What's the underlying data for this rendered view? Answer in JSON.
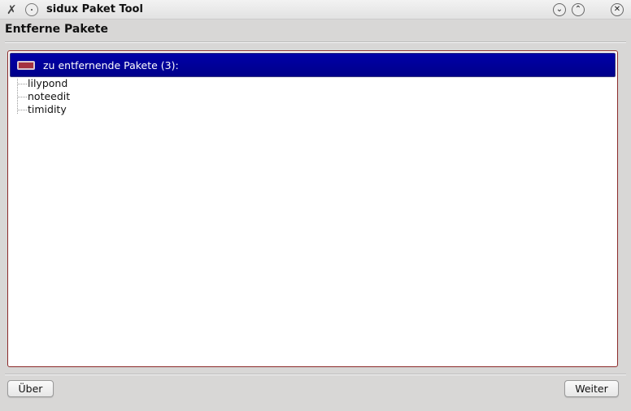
{
  "window": {
    "title": "sidux Paket Tool",
    "app_icon": "tools-icon",
    "buttons": [
      "minimize",
      "maximize",
      "close"
    ]
  },
  "page": {
    "title": "Entferne Pakete"
  },
  "tree": {
    "header": "zu entfernende Pakete (3):",
    "items": [
      "lilypond",
      "noteedit",
      "timidity"
    ]
  },
  "footer": {
    "about_label": "Über",
    "next_label": "Weiter"
  },
  "colors": {
    "header_bg": "#00008a",
    "frame": "#8b2a2a"
  }
}
